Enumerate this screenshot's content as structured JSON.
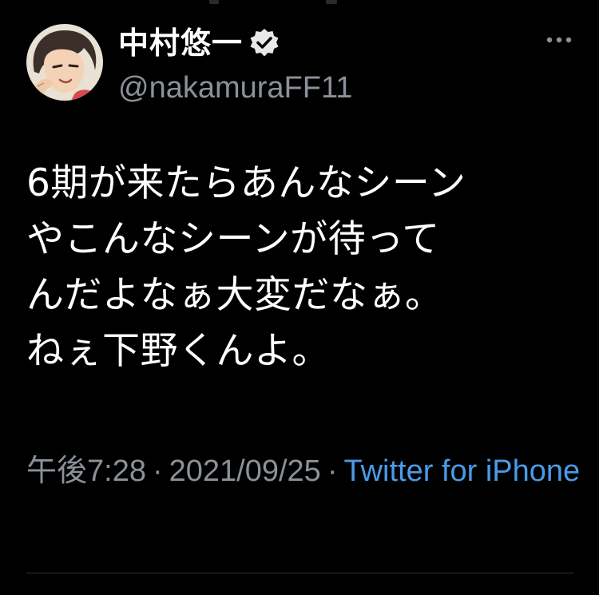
{
  "tweet": {
    "author": {
      "display_name": "中村悠一",
      "handle": "@nakamuraFF11",
      "verified": true,
      "avatar_icon": "profile-avatar-illustration"
    },
    "text": "6期が来たらあんなシーン\nやこんなシーンが待って\nんだよなぁ大変だなぁ。\nねぇ下野くんよ。",
    "time": "午後7:28",
    "separator": "·",
    "date": "2021/09/25",
    "source": "Twitter for iPhone"
  },
  "icons": {
    "more": "more-options-icon",
    "verified": "verified-badge-icon"
  },
  "colors": {
    "background": "#000000",
    "text": "#ffffff",
    "secondary": "#8b9199",
    "link": "#4a9be8",
    "divider": "#2f3336"
  }
}
